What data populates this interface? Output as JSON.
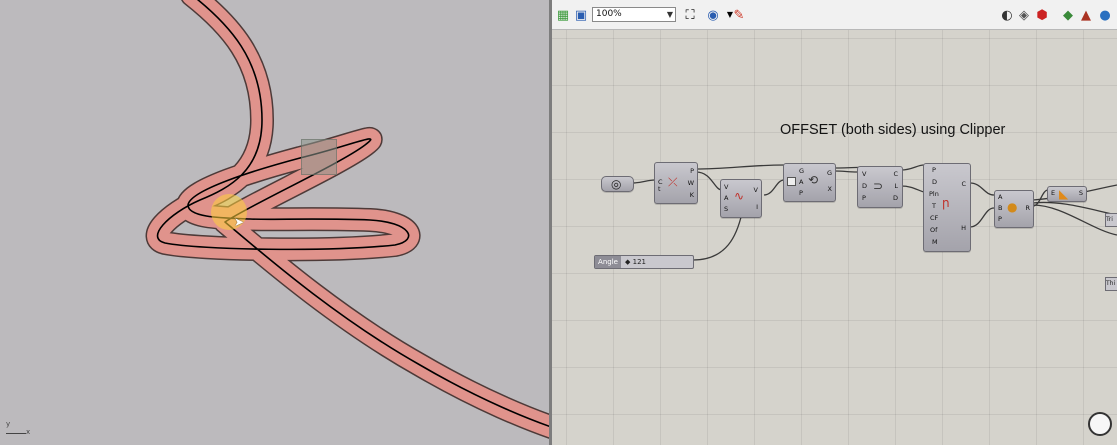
{
  "rhino_viewport": {
    "axis_labels": {
      "y": "y",
      "x": "x"
    },
    "curve_stroke": "#000000",
    "offset_fill": "#e0938c",
    "offset_outline": "#4d3a38"
  },
  "toolbar": {
    "zoom_value": "100%",
    "icons": [
      "open-file-icon",
      "save-icon",
      "zoom-fit-icon",
      "preview-eye-icon",
      "sketch-icon",
      "preview-shaded-icon",
      "bake-icon",
      "preview-toggle-icon",
      "rhino-icon",
      "globe-icon",
      "grasshopper-icon"
    ]
  },
  "canvas": {
    "title": "OFFSET (both sides) using Clipper",
    "angle_slider": {
      "label": "Angle",
      "value": "121"
    },
    "components": {
      "curve_param": {
        "name": "curve-parameter"
      },
      "evaluate_curve": {
        "inputs": [
          "C",
          "t"
        ],
        "outputs": [
          "P",
          "W",
          "K"
        ]
      },
      "rotate_vector": {
        "inputs": [
          "V",
          "A",
          "S"
        ],
        "outputs": [
          "V",
          "I"
        ]
      },
      "rotate": {
        "inputs": [
          "G",
          "A",
          "P"
        ],
        "outputs": [
          "G",
          "X"
        ]
      },
      "move": {
        "inputs": [
          "V",
          "D",
          "P"
        ],
        "outputs": [
          "C",
          "L",
          "D"
        ]
      },
      "clipper_offset": {
        "inputs": [
          "P",
          "D",
          "Pln",
          "T",
          "CF",
          "Of",
          "M"
        ],
        "outputs": [
          "C",
          "H"
        ]
      },
      "boolean_region": {
        "inputs": [
          "A",
          "B",
          "P"
        ],
        "outputs": [
          "R"
        ]
      },
      "result_param": {
        "inputs": [
          "E"
        ],
        "outputs": [
          "S"
        ]
      }
    },
    "side_chips": [
      "Tri",
      "Thi"
    ]
  }
}
